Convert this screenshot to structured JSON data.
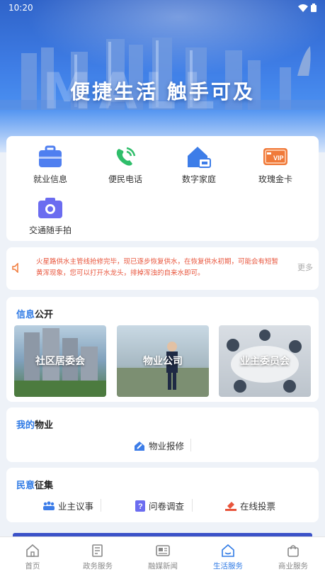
{
  "status_bar": {
    "time": "10:20"
  },
  "banner": {
    "slogan": "便捷生活 触手可及",
    "ghost_text": "MALL"
  },
  "quick_links": [
    {
      "label": "就业信息",
      "icon": "briefcase-icon",
      "color": "#4f7ff0"
    },
    {
      "label": "便民电话",
      "icon": "phone-icon",
      "color": "#2fbe6a"
    },
    {
      "label": "数字家庭",
      "icon": "home-icon",
      "color": "#3d7de8"
    },
    {
      "label": "玫瑰金卡",
      "icon": "vip-card-icon",
      "color": "#f07a3a"
    },
    {
      "label": "交通随手拍",
      "icon": "camera-icon",
      "color": "#6b6cf0"
    }
  ],
  "notice": {
    "text": "火星路供水主管线抢修完毕，现已逐步恢复供水，在恢复供水初期，可能会有短暂黄浑现象，您可以打开水龙头，排掉浑浊的自来水即可。",
    "more": "更多"
  },
  "info_section": {
    "title_highlight": "信息",
    "title_rest": "公开",
    "tiles": [
      {
        "label": "社区居委会"
      },
      {
        "label": "物业公司"
      },
      {
        "label": "业主委员会"
      }
    ]
  },
  "property_section": {
    "title_highlight": "我的",
    "title_rest": "物业",
    "links": [
      {
        "label": "物业报修",
        "icon": "repair-icon"
      }
    ]
  },
  "opinion_section": {
    "title_highlight": "民意",
    "title_rest": "征集",
    "links": [
      {
        "label": "业主议事",
        "icon": "people-icon"
      },
      {
        "label": "问卷调查",
        "icon": "question-icon"
      },
      {
        "label": "在线投票",
        "icon": "vote-icon"
      }
    ]
  },
  "tabbar": {
    "active": "生活服务",
    "tabs": [
      {
        "label": "首页",
        "icon": "home-tab-icon"
      },
      {
        "label": "政务服务",
        "icon": "document-icon"
      },
      {
        "label": "融媒新闻",
        "icon": "news-icon"
      },
      {
        "label": "生活服务",
        "icon": "life-service-icon"
      },
      {
        "label": "商业服务",
        "icon": "shopping-bag-icon"
      }
    ]
  },
  "colors": {
    "accent": "#2f7ae5",
    "notice": "#e8553c",
    "page_bg": "#eef2f8"
  }
}
